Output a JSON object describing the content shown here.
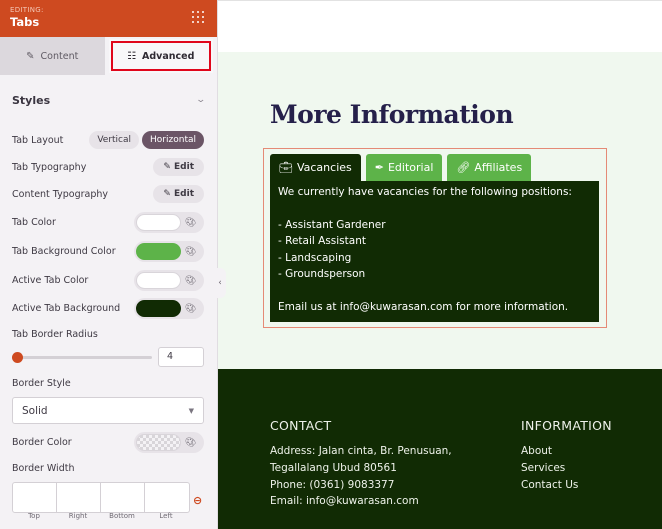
{
  "sidebar": {
    "editing_label": "EDITING:",
    "title": "Tabs",
    "tabs": [
      {
        "label": "Content",
        "icon": "pencil-icon",
        "active": false
      },
      {
        "label": "Advanced",
        "icon": "sliders-icon",
        "active": true
      }
    ],
    "section_title": "Styles",
    "tab_layout": {
      "label": "Tab Layout",
      "options": [
        "Vertical",
        "Horizontal"
      ],
      "selected": "Horizontal"
    },
    "tab_typography": {
      "label": "Tab Typography",
      "button": "Edit"
    },
    "content_typography": {
      "label": "Content Typography",
      "button": "Edit"
    },
    "colors": [
      {
        "label": "Tab Color",
        "value": "#ffffff"
      },
      {
        "label": "Tab Background Color",
        "value": "#5db349"
      },
      {
        "label": "Active Tab Color",
        "value": "#ffffff"
      },
      {
        "label": "Active Tab Background",
        "value": "#112b04"
      }
    ],
    "tab_border_radius": {
      "label": "Tab Border Radius",
      "value": "4"
    },
    "border_style": {
      "label": "Border Style",
      "value": "Solid"
    },
    "border_color": {
      "label": "Border Color",
      "value": "transparent"
    },
    "border_width": {
      "label": "Border Width",
      "sides": [
        "Top",
        "Right",
        "Bottom",
        "Left"
      ]
    }
  },
  "canvas": {
    "heading": "More Information",
    "tabs": [
      {
        "label": "Vacancies",
        "icon": "briefcase-icon",
        "active": true
      },
      {
        "label": "Editorial",
        "icon": "pen-nib-icon",
        "active": false
      },
      {
        "label": "Affiliates",
        "icon": "link-icon",
        "active": false
      }
    ],
    "panel": {
      "intro": "We currently have vacancies for the following positions:",
      "items": [
        "- Assistant Gardener",
        "- Retail Assistant",
        "- Landscaping",
        "- Groundsperson"
      ],
      "outro": "Email us at info@kuwarasan.com for more information."
    },
    "footer": {
      "contact": {
        "heading": "CONTACT",
        "lines": [
          "Address: Jalan cinta, Br. Penusuan,",
          "Tegallalang Ubud 80561",
          "Phone: (0361) 9083377",
          "Email: info@kuwarasan.com"
        ]
      },
      "information": {
        "heading": "INFORMATION",
        "links": [
          "About",
          "Services",
          "Contact Us"
        ]
      }
    }
  },
  "colors": {
    "brand": "#ce4a20",
    "tab_bg": "#5db349",
    "active_tab_bg": "#112b04",
    "highlight_outline": "#e0061b"
  }
}
